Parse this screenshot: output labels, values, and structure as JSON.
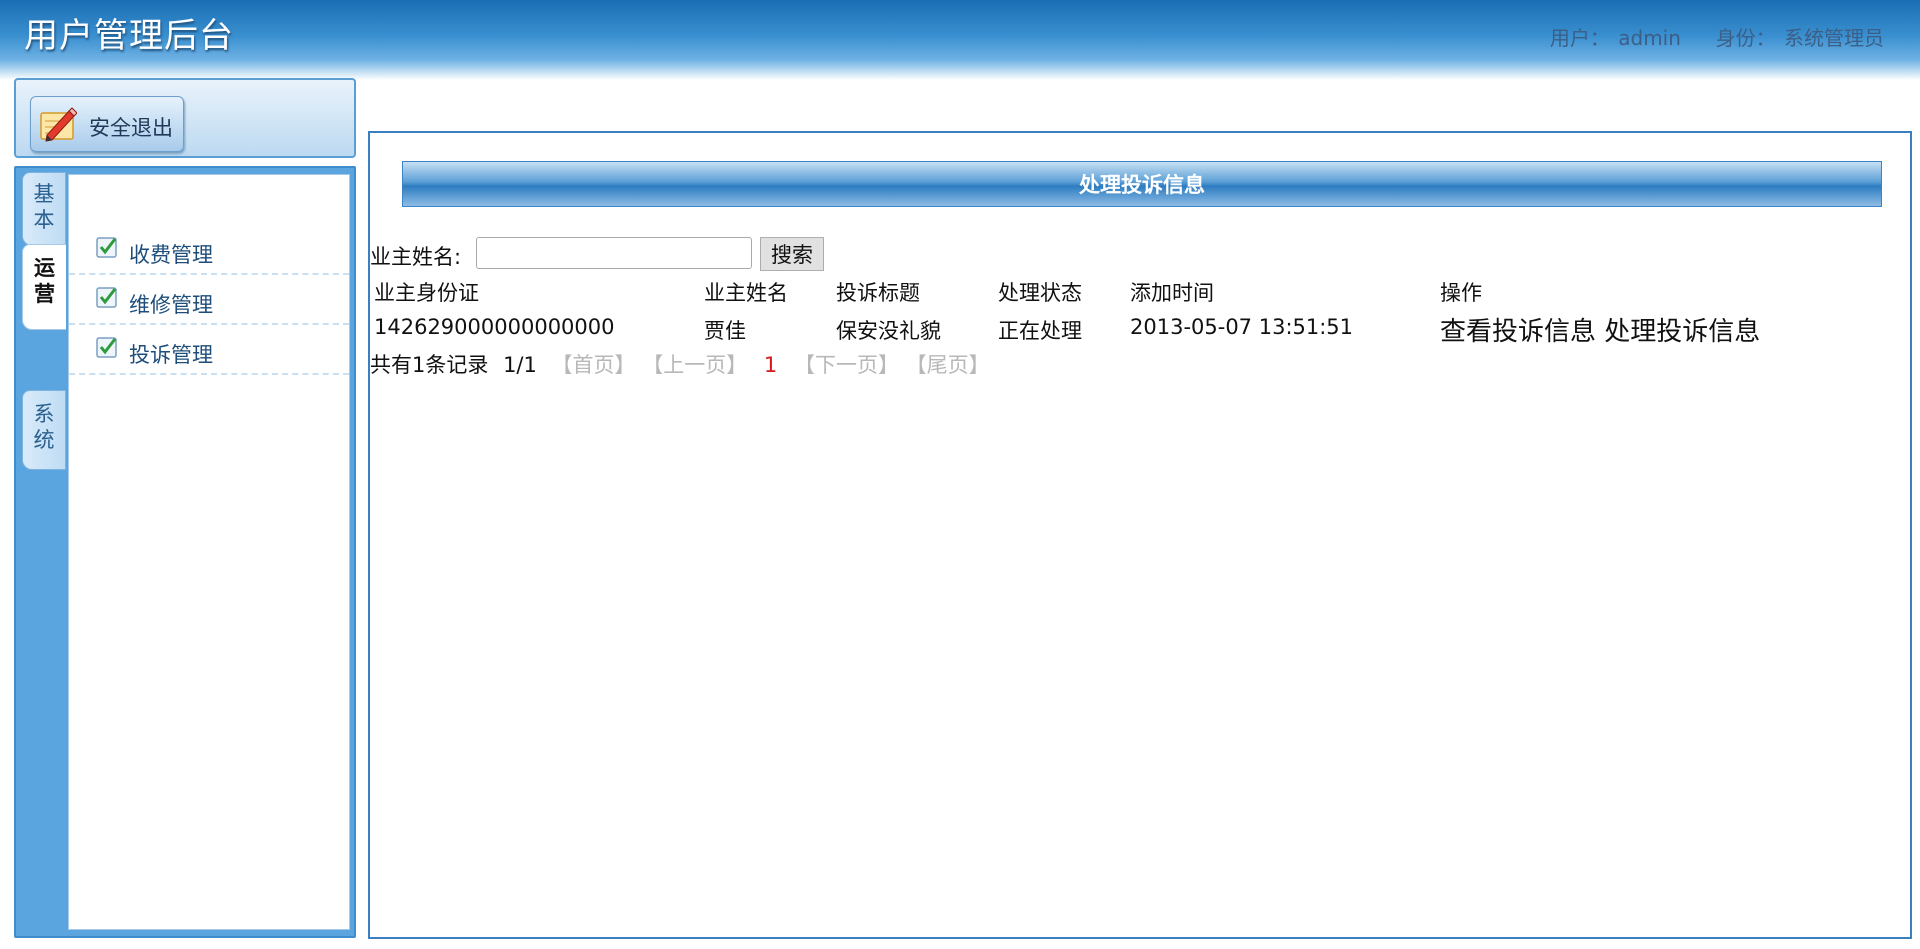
{
  "header": {
    "app_title": "用户管理后台",
    "user_label": "用户：",
    "user_name": "admin",
    "role_label": "身份：",
    "role_name": "系统管理员"
  },
  "sidebar": {
    "logout_label": "安全退出",
    "tabs": [
      {
        "label": "基本",
        "active": false
      },
      {
        "label": "运营",
        "active": true
      },
      {
        "label": "系统",
        "active": false
      }
    ],
    "items": [
      {
        "label": "收费管理"
      },
      {
        "label": "维修管理"
      },
      {
        "label": "投诉管理"
      }
    ]
  },
  "main": {
    "title": "处理投诉信息",
    "search": {
      "label": "业主姓名:",
      "value": "",
      "placeholder": "",
      "button_label": "搜索"
    },
    "table": {
      "columns": [
        "业主身份证",
        "业主姓名",
        "投诉标题",
        "处理状态",
        "添加时间",
        "操作"
      ],
      "rows": [
        {
          "id_card": "142629000000000000",
          "owner_name": "贾佳",
          "title": "保安没礼貌",
          "status": "正在处理",
          "added_time": "2013-05-07 13:51:51",
          "ops": [
            "查看投诉信息",
            "处理投诉信息"
          ]
        }
      ]
    },
    "pager": {
      "total": "共有1条记录",
      "page": "1/1",
      "first": "【首页】",
      "prev": "【上一页】",
      "current": "1",
      "next": "【下一页】",
      "last": "【尾页】"
    }
  },
  "colors": {
    "header_blue": "#1a6fb4",
    "sidebar_blue": "#5aa5e0",
    "border_blue": "#3b7fc0",
    "current_page_red": "#d41a1a",
    "disabled_gray": "#b8b8b8"
  }
}
